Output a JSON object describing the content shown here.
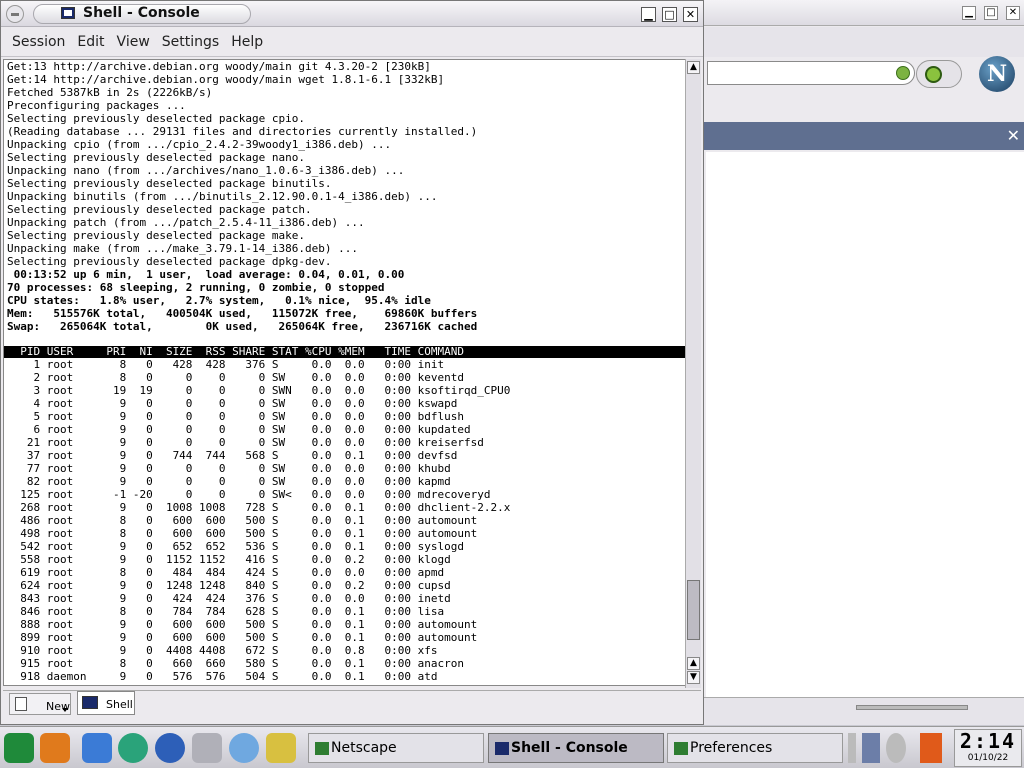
{
  "console": {
    "title": "Shell - Console",
    "menu": [
      "Session",
      "Edit",
      "View",
      "Settings",
      "Help"
    ],
    "tabs": {
      "new_label": "New",
      "shell_label": "Shell"
    },
    "lines": [
      "Get:13 http://archive.debian.org woody/main git 4.3.20-2 [230kB]",
      "Get:14 http://archive.debian.org woody/main wget 1.8.1-6.1 [332kB]",
      "Fetched 5387kB in 2s (2226kB/s)",
      "Preconfiguring packages ...",
      "Selecting previously deselected package cpio.",
      "(Reading database ... 29131 files and directories currently installed.)",
      "Unpacking cpio (from .../cpio_2.4.2-39woody1_i386.deb) ...",
      "Selecting previously deselected package nano.",
      "Unpacking nano (from .../archives/nano_1.0.6-3_i386.deb) ...",
      "Selecting previously deselected package binutils.",
      "Unpacking binutils (from .../binutils_2.12.90.0.1-4_i386.deb) ...",
      "Selecting previously deselected package patch.",
      "Unpacking patch (from .../patch_2.5.4-11_i386.deb) ...",
      "Selecting previously deselected package make.",
      "Unpacking make (from .../make_3.79.1-14_i386.deb) ...",
      "Selecting previously deselected package dpkg-dev."
    ],
    "top_summary": [
      " 00:13:52 up 6 min,  1 user,  load average: 0.04, 0.01, 0.00",
      "70 processes: 68 sleeping, 2 running, 0 zombie, 0 stopped",
      "CPU states:   1.8% user,   2.7% system,   0.1% nice,  95.4% idle",
      "Mem:   515576K total,   400504K used,   115072K free,    69860K buffers",
      "Swap:   265064K total,        0K used,   265064K free,   236716K cached"
    ],
    "process_header": "  PID USER     PRI  NI  SIZE  RSS SHARE STAT %CPU %MEM   TIME COMMAND",
    "processes": [
      "    1 root       8   0   428  428   376 S     0.0  0.0   0:00 init",
      "    2 root       8   0     0    0     0 SW    0.0  0.0   0:00 keventd",
      "    3 root      19  19     0    0     0 SWN   0.0  0.0   0:00 ksoftirqd_CPU0",
      "    4 root       9   0     0    0     0 SW    0.0  0.0   0:00 kswapd",
      "    5 root       9   0     0    0     0 SW    0.0  0.0   0:00 bdflush",
      "    6 root       9   0     0    0     0 SW    0.0  0.0   0:00 kupdated",
      "   21 root       9   0     0    0     0 SW    0.0  0.0   0:00 kreiserfsd",
      "   37 root       9   0   744  744   568 S     0.0  0.1   0:00 devfsd",
      "   77 root       9   0     0    0     0 SW    0.0  0.0   0:00 khubd",
      "   82 root       9   0     0    0     0 SW    0.0  0.0   0:00 kapmd",
      "  125 root      -1 -20     0    0     0 SW<   0.0  0.0   0:00 mdrecoveryd",
      "  268 root       9   0  1008 1008   728 S     0.0  0.1   0:00 dhclient-2.2.x",
      "  486 root       8   0   600  600   500 S     0.0  0.1   0:00 automount",
      "  498 root       8   0   600  600   500 S     0.0  0.1   0:00 automount",
      "  542 root       9   0   652  652   536 S     0.0  0.1   0:00 syslogd",
      "  558 root       9   0  1152 1152   416 S     0.0  0.2   0:00 klogd",
      "  619 root       8   0   484  484   424 S     0.0  0.0   0:00 apmd",
      "  624 root       9   0  1248 1248   840 S     0.0  0.2   0:00 cupsd",
      "  843 root       9   0   424  424   376 S     0.0  0.0   0:00 inetd",
      "  846 root       8   0   784  784   628 S     0.0  0.1   0:00 lisa",
      "  888 root       9   0   600  600   500 S     0.0  0.1   0:00 automount",
      "  899 root       9   0   600  600   500 S     0.0  0.1   0:00 automount",
      "  910 root       9   0  4408 4408   672 S     0.0  0.8   0:00 xfs",
      "  915 root       8   0   660  660   580 S     0.0  0.1   0:00 anacron",
      "  918 daemon     9   0   576  576   504 S     0.0  0.1   0:00 atd"
    ]
  },
  "background_window": {
    "logo_letter": "N"
  },
  "taskbar": {
    "tasks": [
      {
        "label": "Netscape",
        "active": false
      },
      {
        "label": "Shell - Console",
        "active": true
      },
      {
        "label": "Preferences",
        "active": false
      }
    ],
    "clock_time": "2:14",
    "clock_date": "01/10/22"
  },
  "colors": {
    "terminal_bg": "#ffffff",
    "header_bg": "#000000",
    "active_task": "#bcbac4"
  }
}
